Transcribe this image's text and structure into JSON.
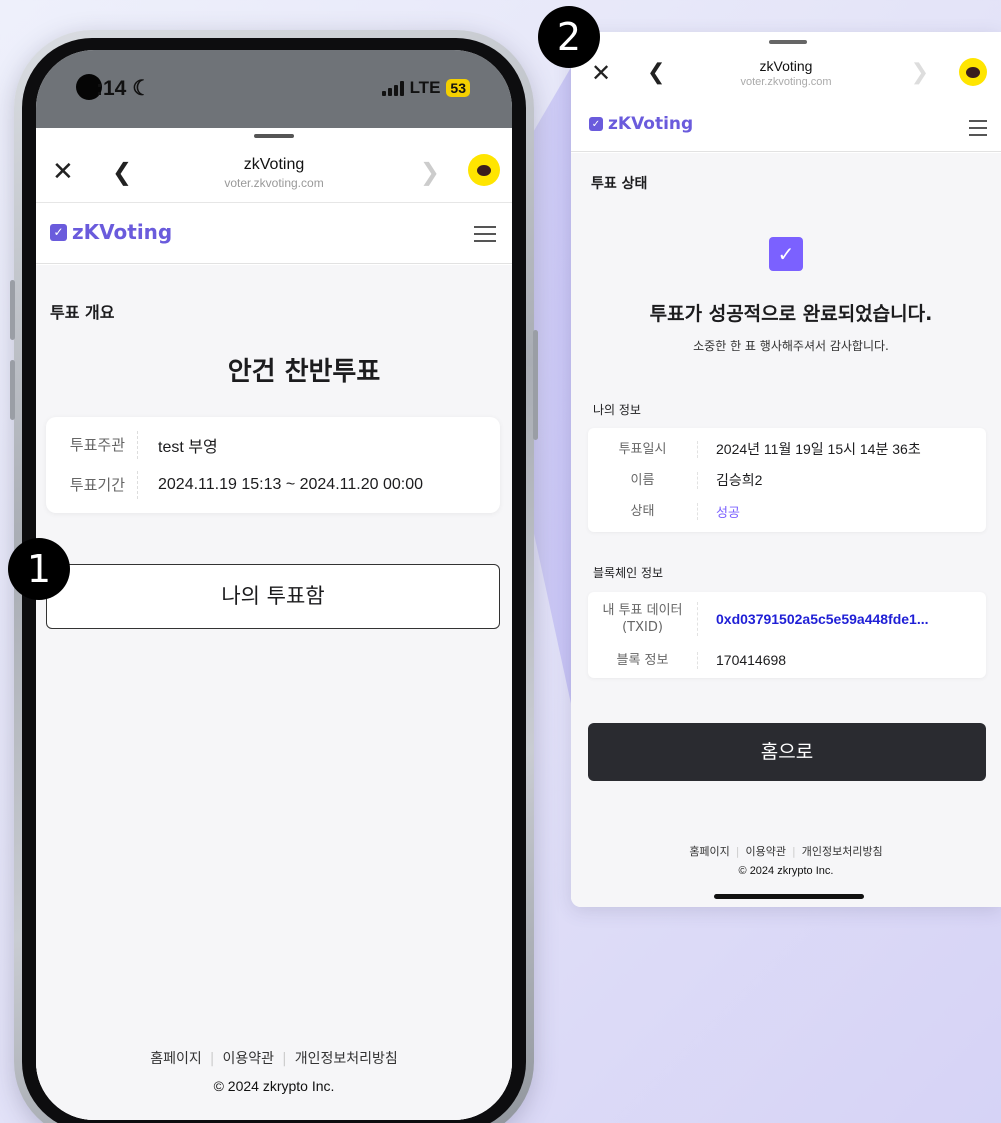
{
  "connector_color": "#9f97ef",
  "accent_color": "#7b61ff",
  "step_badges": [
    "1",
    "2"
  ],
  "left_phone": {
    "status": {
      "time": ":14",
      "moon_icon": "moon-icon",
      "network": "LTE",
      "battery": "53"
    },
    "browser": {
      "title": "zkVoting",
      "url": "voter.zkvoting.com",
      "close_icon": "close-icon",
      "back_icon": "chevron-left-icon",
      "forward_icon": "chevron-right-icon"
    },
    "app": {
      "logo_text": "zKVoting",
      "menu_icon": "hamburger-icon"
    },
    "section_label": "투표 개요",
    "vote_title": "안건 찬반투표",
    "info": [
      {
        "key": "투표주관",
        "value": "test 부영"
      },
      {
        "key": "투표기간",
        "value": "2024.11.19 15:13 ~ 2024.11.20 00:00"
      }
    ],
    "my_ballot_button": "나의 투표함",
    "footer": {
      "links": [
        "홈페이지",
        "이용약관",
        "개인정보처리방침"
      ],
      "copyright": "© 2024 zkrypto Inc."
    }
  },
  "right_panel": {
    "browser": {
      "title": "zkVoting",
      "url": "voter.zkvoting.com"
    },
    "app": {
      "logo_text": "zKVoting"
    },
    "section_label": "투표 상태",
    "success_title": "투표가 성공적으로 완료되었습니다.",
    "success_subtitle": "소중한 한 표 행사해주셔서 감사합니다.",
    "my_info": {
      "label": "나의 정보",
      "rows": [
        {
          "key": "투표일시",
          "value": "2024년 11월 19일 15시 14분 36초"
        },
        {
          "key": "이름",
          "value": "김승희2"
        },
        {
          "key": "상태",
          "value": "성공"
        }
      ]
    },
    "blockchain_info": {
      "label": "블록체인 정보",
      "rows": [
        {
          "key": "내 투표 데이터 (TXID)",
          "value": "0xd03791502a5c5e59a448fde1..."
        },
        {
          "key": "블록 정보",
          "value": "170414698"
        }
      ]
    },
    "home_button": "홈으로",
    "footer": {
      "links": [
        "홈페이지",
        "이용약관",
        "개인정보처리방침"
      ],
      "copyright": "© 2024 zkrypto Inc."
    }
  }
}
